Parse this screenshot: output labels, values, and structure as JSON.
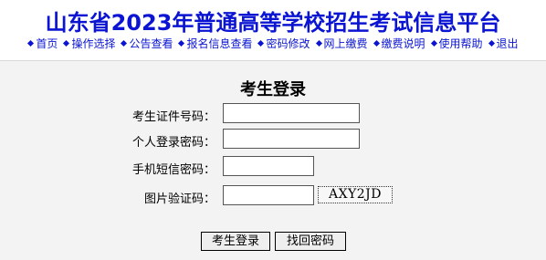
{
  "header": {
    "title": "山东省2023年普通高等学校招生考试信息平台"
  },
  "nav": {
    "items": [
      {
        "label": "首页"
      },
      {
        "label": "操作选择"
      },
      {
        "label": "公告查看"
      },
      {
        "label": "报名信息查看"
      },
      {
        "label": "密码修改"
      },
      {
        "label": "网上缴费"
      },
      {
        "label": "缴费说明"
      },
      {
        "label": "使用帮助"
      },
      {
        "label": "退出"
      }
    ]
  },
  "login": {
    "title": "考生登录",
    "fields": {
      "id_number": {
        "label": "考生证件号码：",
        "value": ""
      },
      "password": {
        "label": "个人登录密码：",
        "value": ""
      },
      "sms_code": {
        "label": "手机短信密码：",
        "value": ""
      },
      "captcha_input": {
        "label": "图片验证码：",
        "value": ""
      }
    },
    "captcha_text": "AXY2JD",
    "buttons": {
      "login": "考生登录",
      "recover": "找回密码"
    }
  },
  "colors": {
    "accent": "#0a14d2",
    "background_main": "#f3f3f3"
  }
}
